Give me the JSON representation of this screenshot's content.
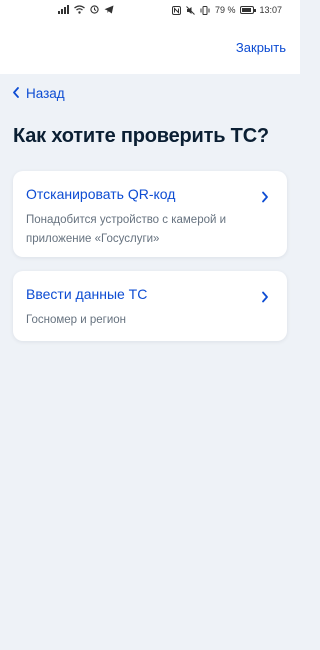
{
  "status_bar": {
    "battery_percent": "79 %",
    "time": "13:07"
  },
  "header": {
    "close_label": "Закрыть"
  },
  "nav": {
    "back_label": "Назад"
  },
  "main": {
    "title": "Как хотите проверить ТС?",
    "options": [
      {
        "title": "Отсканировать QR-код",
        "description": "Понадобится устройство с камерой и приложение «Госуслуги»"
      },
      {
        "title": "Ввести данные ТС",
        "description": "Госномер и регион"
      }
    ]
  },
  "colors": {
    "accent": "#0d4cd3",
    "background": "#eef2f7",
    "title": "#0b1f33",
    "muted": "#66727f"
  }
}
